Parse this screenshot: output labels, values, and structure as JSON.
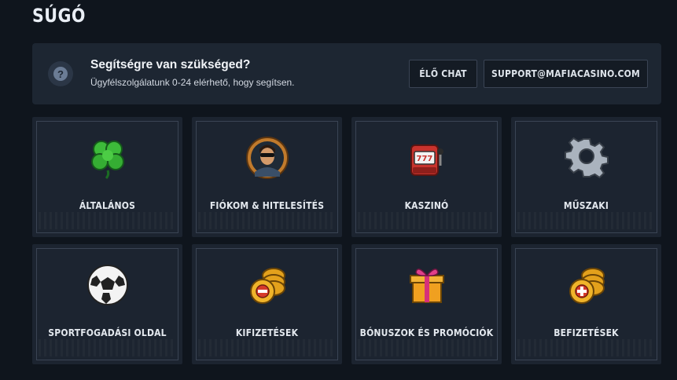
{
  "page": {
    "title": "SÚGÓ"
  },
  "help": {
    "title": "Segítségre van szükséged?",
    "subtitle": "Ügyfélszolgálatunk 0-24 elérhető, hogy segítsen.",
    "icon": "question-icon",
    "chat_label": "ÉLŐ CHAT",
    "email_label": "SUPPORT@MAFIACASINO.COM"
  },
  "categories": [
    {
      "label": "ÁLTALÁNOS",
      "icon": "clover-icon"
    },
    {
      "label": "FIÓKOM & HITELESÍTÉS",
      "icon": "avatar-icon"
    },
    {
      "label": "KASZINÓ",
      "icon": "slot-machine-icon"
    },
    {
      "label": "MŰSZAKI",
      "icon": "gear-icon"
    },
    {
      "label": "SPORTFOGADÁSI OLDAL",
      "icon": "soccer-ball-icon"
    },
    {
      "label": "KIFIZETÉSEK",
      "icon": "coins-minus-icon"
    },
    {
      "label": "BÓNUSZOK ÉS PROMÓCIÓK",
      "icon": "gift-icon"
    },
    {
      "label": "BEFIZETÉSEK",
      "icon": "coins-plus-icon"
    }
  ],
  "colors": {
    "background": "#0f151d",
    "panel": "#1d2632",
    "card": "#1c2430",
    "border": "#3a4454"
  }
}
